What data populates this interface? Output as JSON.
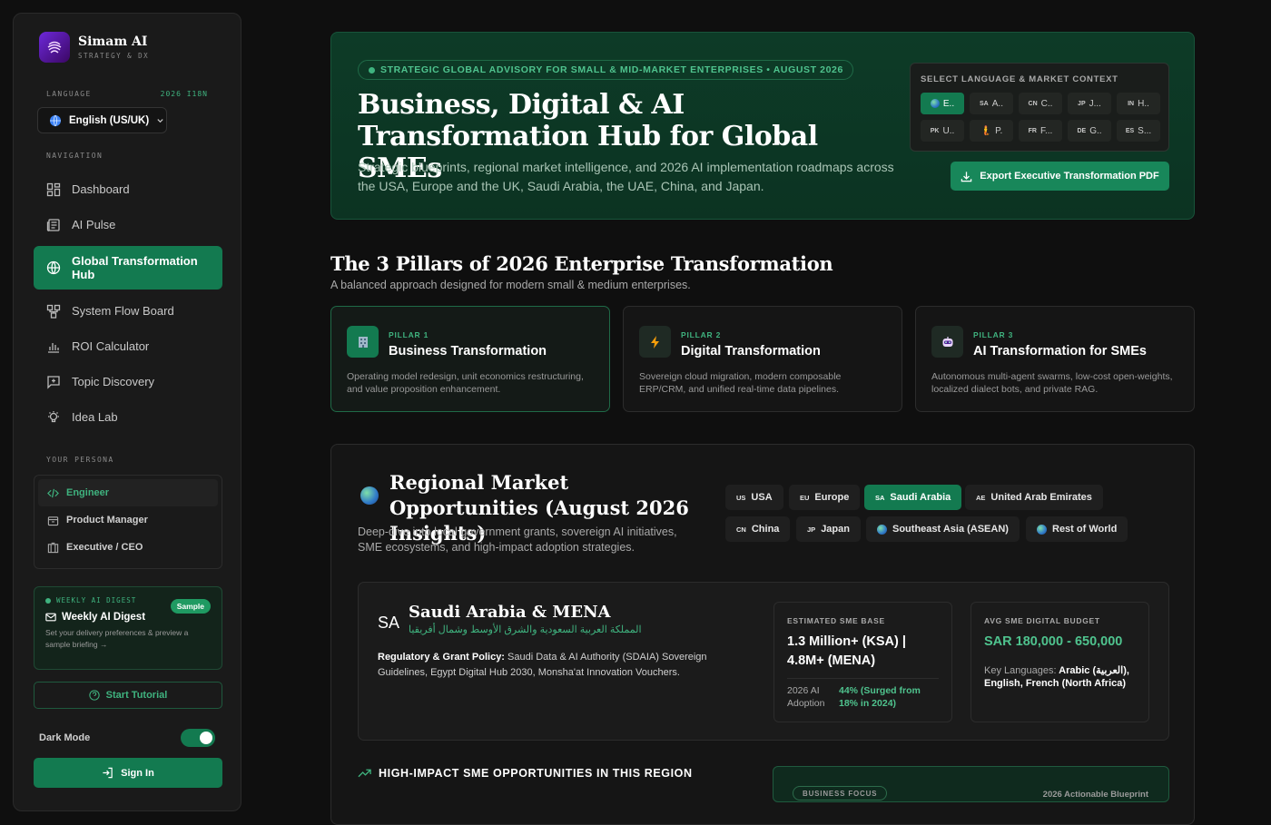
{
  "brand": {
    "name": "Simam AI",
    "subtitle": "STRATEGY & DX"
  },
  "language": {
    "section_label": "LANGUAGE",
    "badge": "2026 I18N",
    "selected": "English (US/UK)"
  },
  "navigation": {
    "section_label": "NAVIGATION",
    "items": [
      {
        "label": "Dashboard",
        "icon": "dashboard-icon"
      },
      {
        "label": "AI Pulse",
        "icon": "newspaper-icon"
      },
      {
        "label": "Global Transformation Hub",
        "icon": "globe-icon",
        "active": true
      },
      {
        "label": "System Flow Board",
        "icon": "flow-icon"
      },
      {
        "label": "ROI Calculator",
        "icon": "bar-chart-icon"
      },
      {
        "label": "Topic Discovery",
        "icon": "plus-square-icon"
      },
      {
        "label": "Idea Lab",
        "icon": "lightbulb-icon"
      }
    ]
  },
  "persona": {
    "section_label": "YOUR PERSONA",
    "items": [
      {
        "label": "Engineer",
        "icon": "code-icon",
        "active": true
      },
      {
        "label": "Product Manager",
        "icon": "box-icon"
      },
      {
        "label": "Executive / CEO",
        "icon": "building-icon"
      }
    ]
  },
  "digest": {
    "tag": "WEEKLY AI DIGEST",
    "badge": "Sample",
    "title": "Weekly AI Digest",
    "text": "Set your delivery preferences & preview a sample briefing →"
  },
  "tutorial_label": "Start Tutorial",
  "dark_mode": {
    "label": "Dark Mode",
    "enabled": true
  },
  "signin_label": "Sign In",
  "hero": {
    "tag": "STRATEGIC GLOBAL ADVISORY FOR SMALL & MID-MARKET ENTERPRISES • AUGUST 2026",
    "title": "Business, Digital & AI Transformation Hub for Global SMEs",
    "subtitle": "Strategic blueprints, regional market intelligence, and 2026 AI implementation roadmaps across the USA, Europe and the UK, Saudi Arabia, the UAE, China, and Japan.",
    "context_label": "SELECT LANGUAGE & MARKET CONTEXT",
    "contexts": [
      {
        "code": "",
        "label": "E..",
        "globe": true,
        "active": true
      },
      {
        "code": "SA",
        "label": "A.."
      },
      {
        "code": "CN",
        "label": "C.."
      },
      {
        "code": "JP",
        "label": "J..."
      },
      {
        "code": "IN",
        "label": "H.."
      },
      {
        "code": "PK",
        "label": "U.."
      },
      {
        "code": "🧜",
        "label": "P."
      },
      {
        "code": "FR",
        "label": "F..."
      },
      {
        "code": "DE",
        "label": "G.."
      },
      {
        "code": "ES",
        "label": "S..."
      }
    ],
    "export_label": "Export Executive Transformation PDF"
  },
  "pillars": {
    "title": "The 3 Pillars of 2026 Enterprise Transformation",
    "subtitle": "A balanced approach designed for modern small & medium enterprises.",
    "items": [
      {
        "num": "PILLAR 1",
        "title": "Business Transformation",
        "desc": "Operating model redesign, unit economics restructuring, and value proposition enhancement.",
        "icon": "building-icon"
      },
      {
        "num": "PILLAR 2",
        "title": "Digital Transformation",
        "desc": "Sovereign cloud migration, modern composable ERP/CRM, and unified real-time data pipelines.",
        "icon": "lightning-icon"
      },
      {
        "num": "PILLAR 3",
        "title": "AI Transformation for SMEs",
        "desc": "Autonomous multi-agent swarms, low-cost open-weights, localized dialect bots, and private RAG.",
        "icon": "robot-icon"
      }
    ]
  },
  "region": {
    "title": "Regional Market Opportunities (August 2026 Insights)",
    "subtitle": "Deep-dive into local government grants, sovereign AI initiatives, SME ecosystems, and high-impact adoption strategies.",
    "chips": [
      {
        "code": "US",
        "label": "USA"
      },
      {
        "code": "EU",
        "label": "Europe"
      },
      {
        "code": "SA",
        "label": "Saudi Arabia",
        "active": true
      },
      {
        "code": "AE",
        "label": "United Arab Emirates"
      },
      {
        "code": "CN",
        "label": "China"
      },
      {
        "code": "JP",
        "label": "Japan"
      },
      {
        "code": "",
        "label": "Southeast Asia (ASEAN)",
        "globe": true
      },
      {
        "code": "",
        "label": "Rest of World",
        "globe": true
      }
    ],
    "detail": {
      "code": "SA",
      "title": "Saudi Arabia & MENA",
      "arabic": "المملكة العربية السعودية والشرق الأوسط وشمال أفريقيا",
      "policy_label": "Regulatory & Grant Policy:",
      "policy_text": " Saudi Data & AI Authority (SDAIA) Sovereign Guidelines, Egypt Digital Hub 2030, Monsha'at Innovation Vouchers.",
      "sme_label": "ESTIMATED SME BASE",
      "sme_value": "1.3 Million+ (KSA) | 4.8M+ (MENA)",
      "adoption_label": "2026 AI Adoption",
      "adoption_value": "44% (Surged from 18% in 2024)",
      "budget_label": "AVG SME DIGITAL BUDGET",
      "budget_value": "SAR 180,000 - 650,000",
      "languages_label": "Key Languages:",
      "languages_value": " Arabic (العربية), English, French (North Africa)"
    },
    "opportunities_label": "HIGH-IMPACT SME OPPORTUNITIES IN THIS REGION",
    "blueprint_tag": "BUSINESS FOCUS",
    "blueprint_right": "2026 Actionable Blueprint"
  },
  "colors": {
    "accent": "#137a50",
    "accent_text": "#3fb37f",
    "bg": "#0f0f0f",
    "panel": "#1a1a1a"
  }
}
